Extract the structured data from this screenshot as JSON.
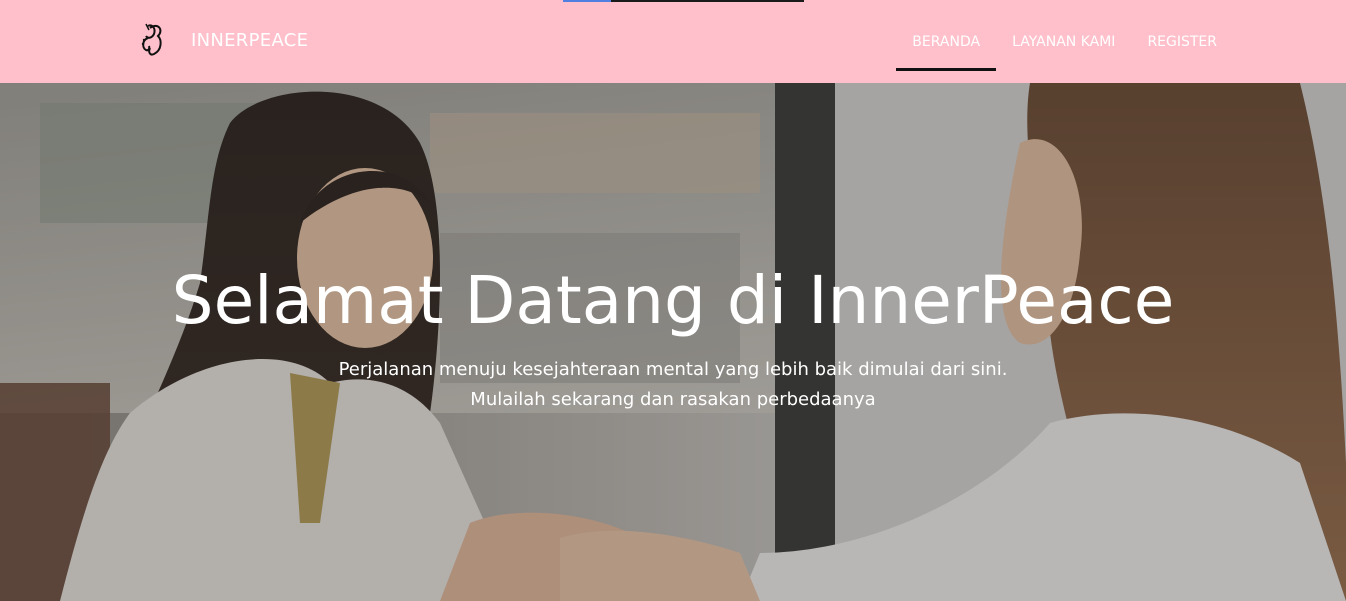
{
  "progress": {
    "fraction": 0.2,
    "fill_color": "#4f7fe0"
  },
  "navbar": {
    "background": "#ffc0cb",
    "brand": {
      "icon": "butterfly-icon",
      "name": "INNERPEACE"
    },
    "links": [
      {
        "label": "BERANDA",
        "active": true
      },
      {
        "label": "LAYANAN KAMI",
        "active": false
      },
      {
        "label": "REGISTER",
        "active": false
      }
    ]
  },
  "hero": {
    "title_prefix": "Selamat Datang di ",
    "title_brand": "InnerPeace",
    "subtitle_line1": "Perjalanan menuju kesejahteraan mental yang lebih baik dimulai dari sini.",
    "subtitle_line2": "Mulailah sekarang dan rasakan perbedaanya"
  }
}
